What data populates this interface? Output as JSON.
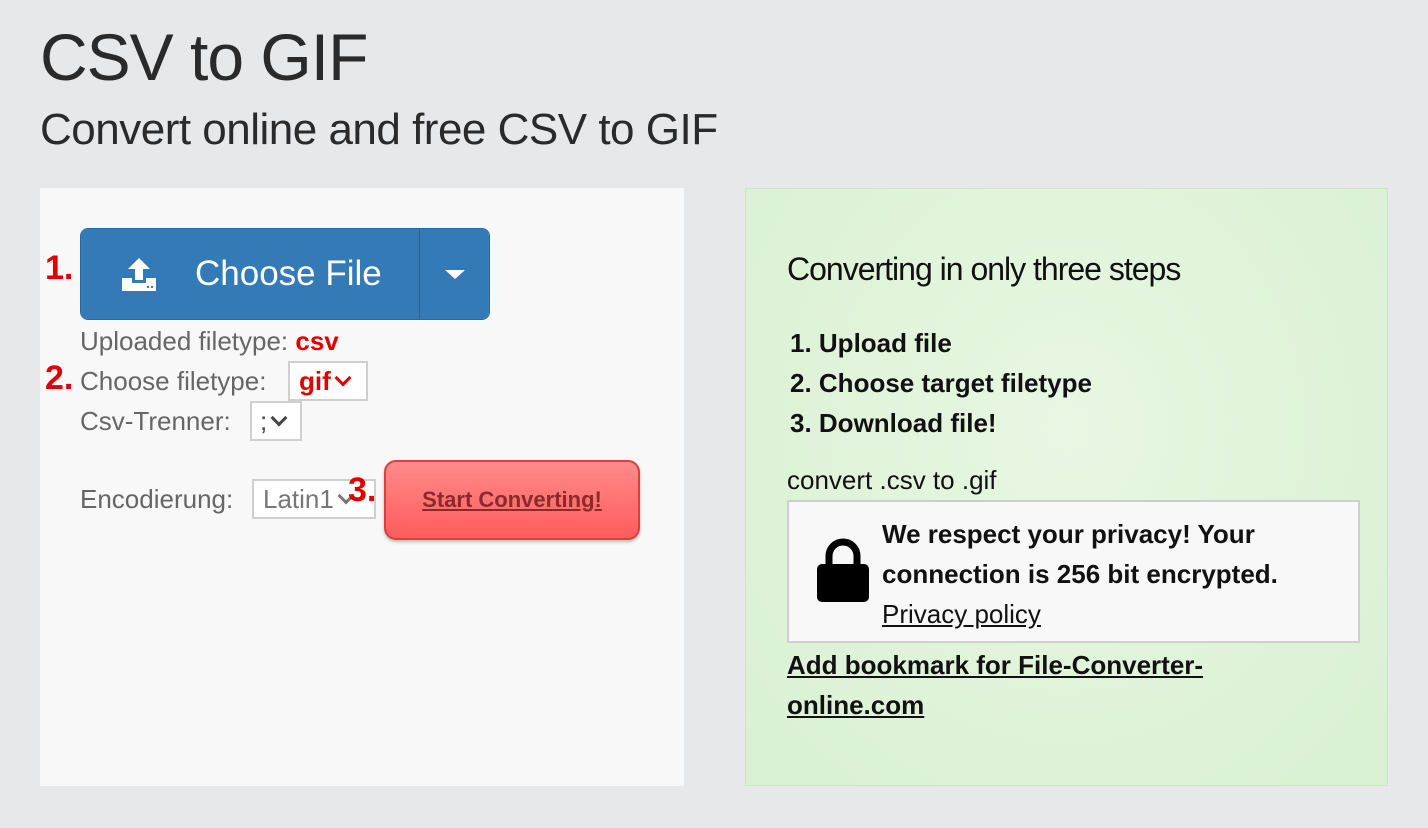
{
  "header": {
    "title": "CSV to GIF",
    "subtitle": "Convert online and free CSV to GIF"
  },
  "converter": {
    "steps": [
      "1.",
      "2.",
      "3."
    ],
    "choose_file_label": "Choose File",
    "uploaded_filetype_label": "Uploaded filetype:",
    "uploaded_filetype_value": "csv",
    "choose_filetype_label": "Choose filetype:",
    "choose_filetype_value": "gif",
    "csv_separator_label": "Csv-Trenner:",
    "csv_separator_value": ";",
    "encoding_label": "Encodierung:",
    "encoding_value": "Latin1",
    "start_button_label": "Start Converting!"
  },
  "info": {
    "heading": "Converting in only three steps",
    "steps": [
      "1. Upload file",
      "2. Choose target filetype",
      "3. Download file!"
    ],
    "convert_note": "convert .csv to .gif",
    "privacy_text": "We respect your privacy! Your connection is 256 bit encrypted.",
    "privacy_link": "Privacy policy",
    "bookmark_link": "Add bookmark for File-Converter-online.com"
  },
  "icons": {
    "upload": "upload-icon",
    "dropdown": "caret-down-icon",
    "select": "chevron-down-icon",
    "lock": "lock-icon"
  },
  "colors": {
    "background": "#e7e8ea",
    "primary_button": "#337ab7",
    "accent_red": "#e00000",
    "start_button": "#ff6b6b",
    "info_panel": "#dcf2d5"
  }
}
